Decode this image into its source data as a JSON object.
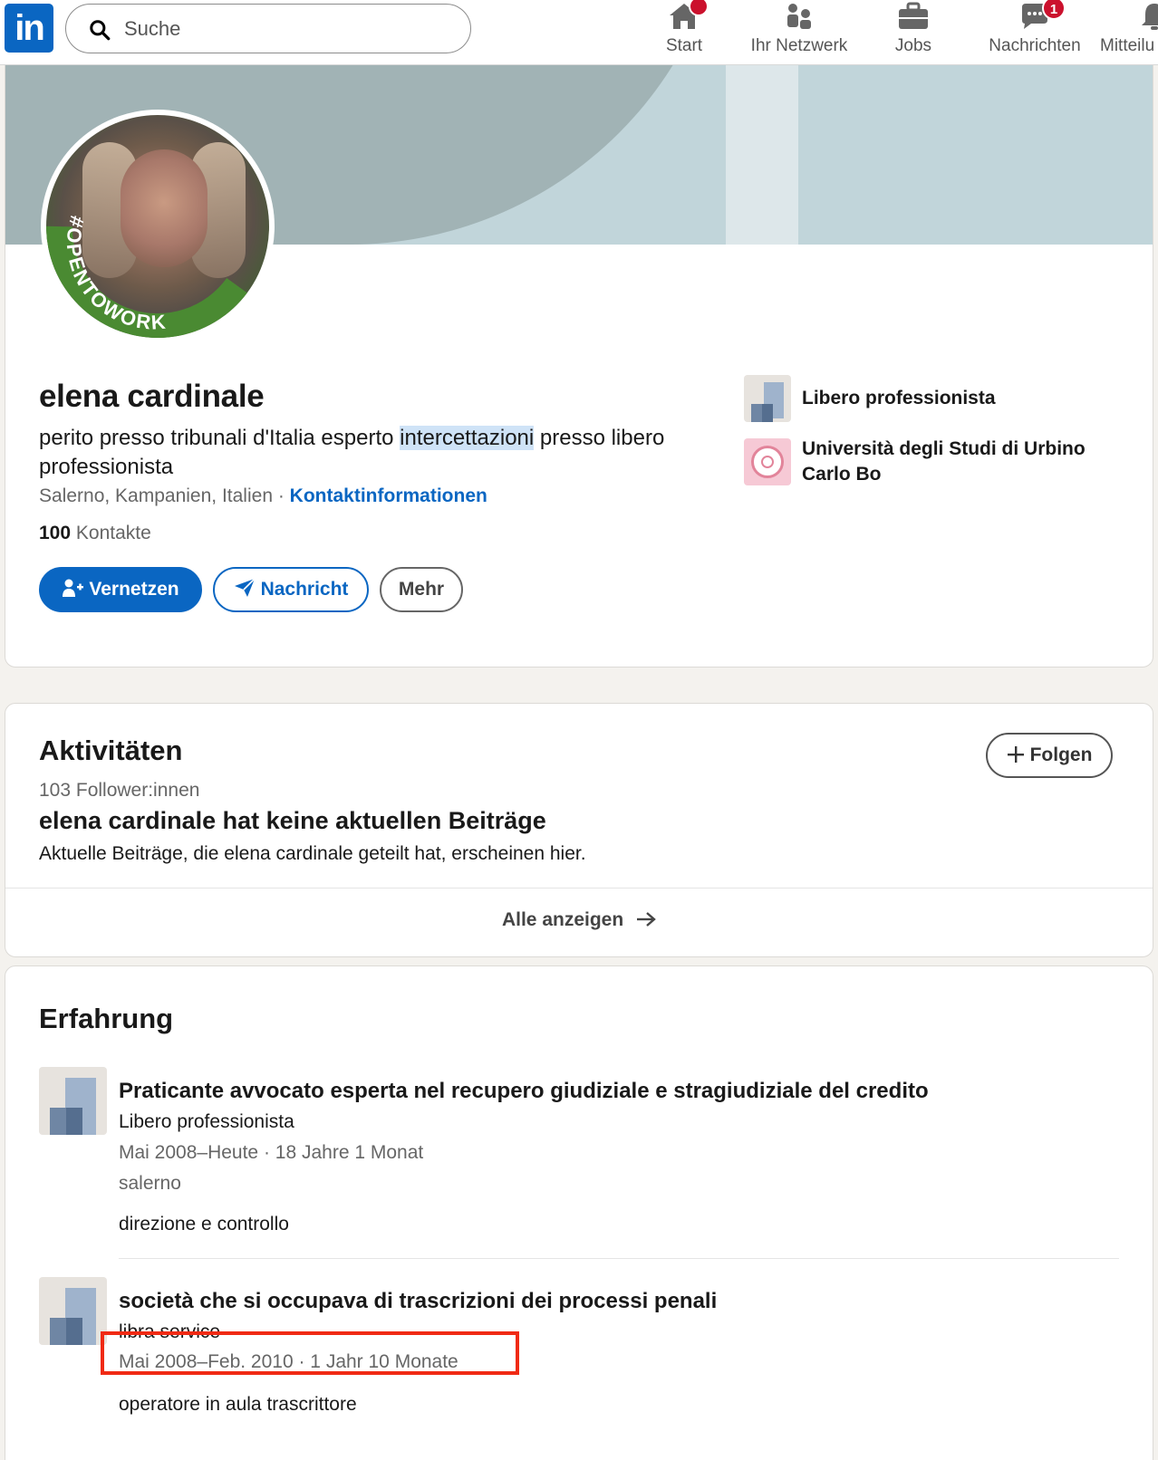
{
  "nav": {
    "logo_text": "in",
    "search_placeholder": "Suche",
    "items": [
      {
        "label": "Start",
        "icon": "home-icon",
        "badge": ""
      },
      {
        "label": "Ihr Netzwerk",
        "icon": "network-icon",
        "badge": ""
      },
      {
        "label": "Jobs",
        "icon": "briefcase-icon",
        "badge": ""
      },
      {
        "label": "Nachrichten",
        "icon": "messaging-icon",
        "badge": "1"
      },
      {
        "label": "Mitteilu",
        "icon": "bell-icon",
        "badge": ""
      }
    ]
  },
  "profile": {
    "avatar_frame_text": "#OPENTOWORK",
    "name": "elena cardinale",
    "headline_before": "perito presso tribunali d'Italia esperto ",
    "headline_highlight": "intercettazioni",
    "headline_after": " presso libero professionista",
    "location": "Salerno, Kampanien, Italien",
    "separator": " · ",
    "contact_info_label": "Kontaktinformationen",
    "connections_count": "100",
    "connections_label": " Kontakte",
    "buttons": {
      "connect": "Vernetzen",
      "message": "Nachricht",
      "more": "Mehr"
    },
    "current_company": "Libero professionista",
    "education": "Università degli Studi di Urbino Carlo Bo"
  },
  "activity": {
    "title": "Aktivitäten",
    "follow_label": "Folgen",
    "followers": "103 Follower:innen",
    "empty_title": "elena cardinale hat keine aktuellen Beiträge",
    "empty_text": "Aktuelle Beiträge, die elena cardinale geteilt hat, erscheinen hier.",
    "show_all": "Alle anzeigen"
  },
  "experience": {
    "title": "Erfahrung",
    "items": [
      {
        "title": "Praticante avvocato esperta nel recupero giudiziale e stragiudiziale del credito",
        "company": "Libero professionista",
        "dates": "Mai 2008–Heute · 18 Jahre 1 Monat",
        "location": "salerno",
        "description": "direzione e controllo"
      },
      {
        "title": "società che si occupava di trascrizioni dei processi penali",
        "company": "libra service",
        "dates": "Mai 2008–Feb. 2010 · 1 Jahr 10 Monate",
        "description": "operatore in aula trascrittore"
      }
    ]
  },
  "colors": {
    "brand_blue": "#0a66c2",
    "badge_red": "#cb112d",
    "annotation_red": "#f02a14",
    "open_to_work_green": "#4a8a32"
  }
}
